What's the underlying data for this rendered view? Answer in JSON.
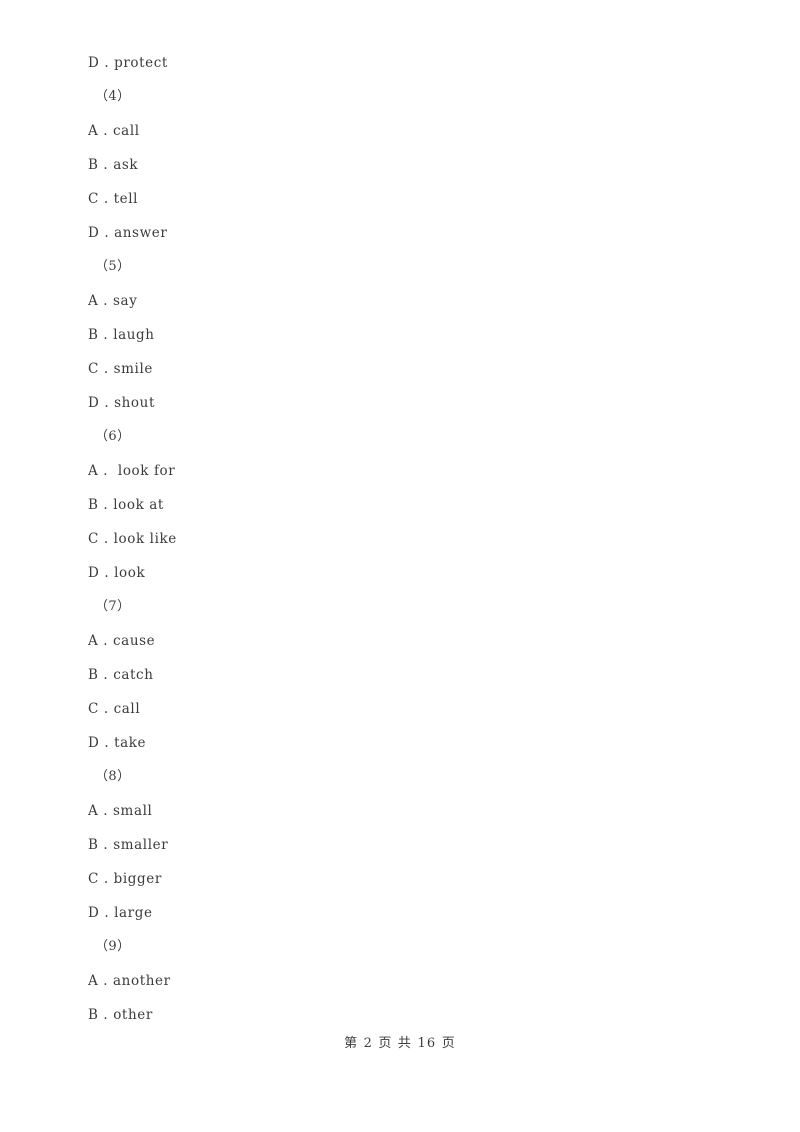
{
  "document": {
    "page_number": 2,
    "total_pages": 16,
    "footer_text": "第 2 页 共 16 页"
  },
  "lines": [
    {
      "kind": "option",
      "text": "D . protect"
    },
    {
      "kind": "question",
      "text": "（4）"
    },
    {
      "kind": "option",
      "text": "A . call"
    },
    {
      "kind": "option",
      "text": "B . ask"
    },
    {
      "kind": "option",
      "text": "C . tell"
    },
    {
      "kind": "option",
      "text": "D . answer"
    },
    {
      "kind": "question",
      "text": "（5）"
    },
    {
      "kind": "option",
      "text": "A . say"
    },
    {
      "kind": "option",
      "text": "B . laugh"
    },
    {
      "kind": "option",
      "text": "C . smile"
    },
    {
      "kind": "option",
      "text": "D . shout"
    },
    {
      "kind": "question",
      "text": "（6）"
    },
    {
      "kind": "option",
      "text": "A .  look for"
    },
    {
      "kind": "option",
      "text": "B . look at"
    },
    {
      "kind": "option",
      "text": "C . look like"
    },
    {
      "kind": "option",
      "text": "D . look"
    },
    {
      "kind": "question",
      "text": "（7）"
    },
    {
      "kind": "option",
      "text": "A . cause"
    },
    {
      "kind": "option",
      "text": "B . catch"
    },
    {
      "kind": "option",
      "text": "C . call"
    },
    {
      "kind": "option",
      "text": "D . take"
    },
    {
      "kind": "question",
      "text": "（8）"
    },
    {
      "kind": "option",
      "text": "A . small"
    },
    {
      "kind": "option",
      "text": "B . smaller"
    },
    {
      "kind": "option",
      "text": "C . bigger"
    },
    {
      "kind": "option",
      "text": "D . large"
    },
    {
      "kind": "question",
      "text": "（9）"
    },
    {
      "kind": "option",
      "text": "A . another"
    },
    {
      "kind": "option",
      "text": "B . other"
    }
  ]
}
